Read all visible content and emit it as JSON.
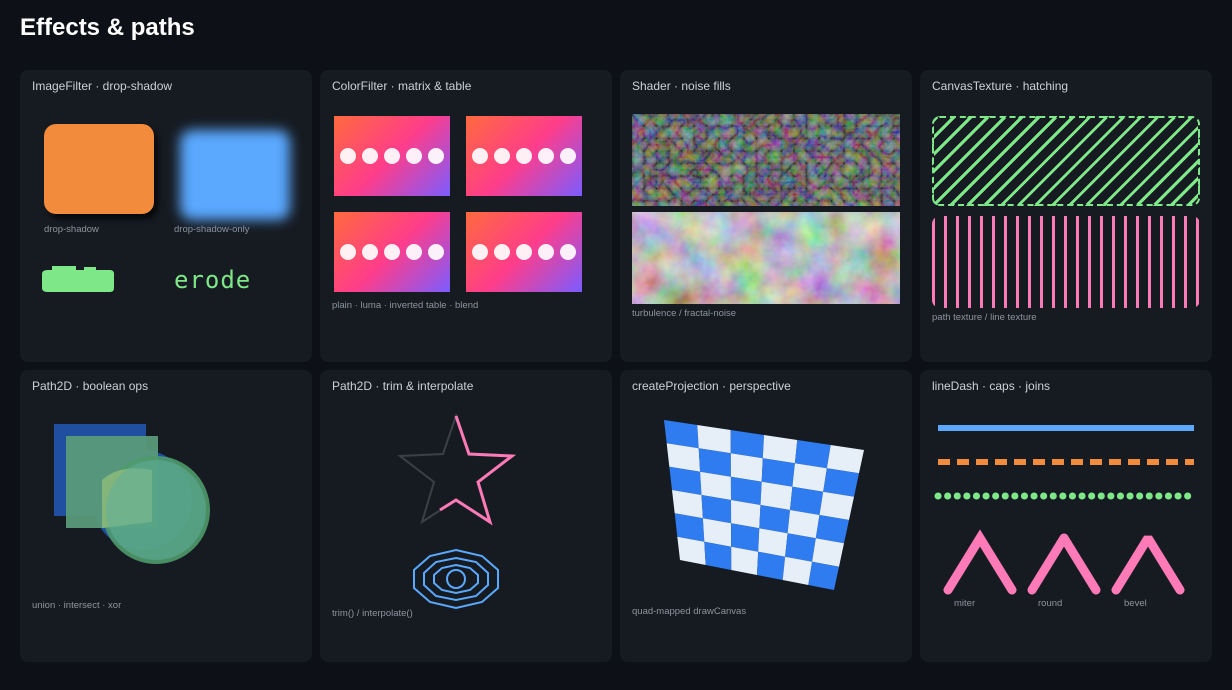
{
  "page": {
    "title": "Effects & paths"
  },
  "cards": [
    {
      "title": "ImageFilter · drop-shadow",
      "captions": {
        "drop_shadow": "drop-shadow",
        "drop_shadow_only": "drop-shadow-only"
      },
      "erode_text": "erode"
    },
    {
      "title": "ColorFilter · matrix & table",
      "caption": "plain · luma · inverted table · blend"
    },
    {
      "title": "Shader · noise fills",
      "caption": "turbulence / fractal-noise"
    },
    {
      "title": "CanvasTexture · hatching",
      "caption": "path texture / line texture"
    },
    {
      "title": "Path2D · boolean ops",
      "caption": "union · intersect · xor"
    },
    {
      "title": "Path2D · trim & interpolate",
      "caption": "trim() / interpolate()"
    },
    {
      "title": "createProjection · perspective",
      "caption": "quad-mapped drawCanvas"
    },
    {
      "title": "lineDash · caps · joins",
      "joins": {
        "miter": "miter",
        "round": "round",
        "bevel": "bevel"
      }
    }
  ],
  "colors": {
    "background": "#0d1117",
    "card": "#161b22",
    "orange": "#f28c3c",
    "blue": "#5aa8ff",
    "green": "#7ee787",
    "pink": "#ff7ab6",
    "checker_blue": "#2f7bf0",
    "checker_light": "#e6eef7"
  }
}
